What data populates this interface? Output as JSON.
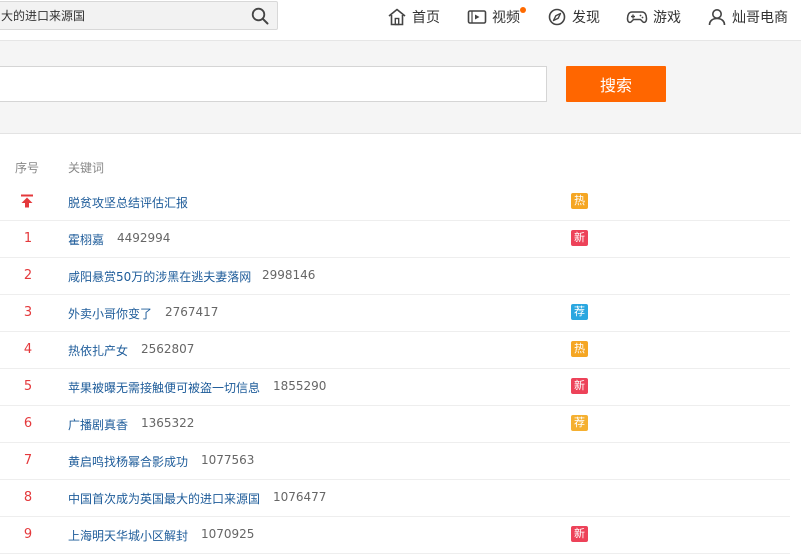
{
  "topbar": {
    "search_value": "大的进口来源国",
    "nav": [
      {
        "label": "首页",
        "icon": "home-icon"
      },
      {
        "label": "视频",
        "icon": "video-icon",
        "dot": true
      },
      {
        "label": "发现",
        "icon": "compass-icon"
      },
      {
        "label": "游戏",
        "icon": "gamepad-icon"
      },
      {
        "label": "灿哥电商",
        "icon": "user-icon"
      }
    ]
  },
  "search": {
    "value": "",
    "button_label": "搜索"
  },
  "table": {
    "headers": [
      "序号",
      "关键词"
    ],
    "rows": [
      {
        "rank": "",
        "pinned": true,
        "keyword": "脱贫攻坚总结评估汇报",
        "count": "",
        "badge": "热",
        "badge_color": "#f5a623"
      },
      {
        "rank": "1",
        "keyword": "霍栩嘉",
        "count": "4492994",
        "badge": "新",
        "badge_color": "#ed4259"
      },
      {
        "rank": "2",
        "keyword": "咸阳悬赏50万的涉黑在逃夫妻落网",
        "count": "2998146",
        "badge": "",
        "badge_color": ""
      },
      {
        "rank": "3",
        "keyword": "外卖小哥你变了",
        "count": "2767417",
        "badge": "荐",
        "badge_color": "#2aa7e0"
      },
      {
        "rank": "4",
        "keyword": "热依扎产女",
        "count": "2562807",
        "badge": "热",
        "badge_color": "#f5a623"
      },
      {
        "rank": "5",
        "keyword": "苹果被曝无需接触便可被盗一切信息",
        "count": "1855290",
        "badge": "新",
        "badge_color": "#ed4259"
      },
      {
        "rank": "6",
        "keyword": "广播剧真香",
        "count": "1365322",
        "badge": "荐",
        "badge_color": "#f5b031"
      },
      {
        "rank": "7",
        "keyword": "黄启鸣找杨幂合影成功",
        "count": "1077563",
        "badge": "",
        "badge_color": ""
      },
      {
        "rank": "8",
        "keyword": "中国首次成为英国最大的进口来源国",
        "count": "1076477",
        "badge": "",
        "badge_color": ""
      },
      {
        "rank": "9",
        "keyword": "上海明天华城小区解封",
        "count": "1070925",
        "badge": "新",
        "badge_color": "#ed4259"
      }
    ]
  }
}
